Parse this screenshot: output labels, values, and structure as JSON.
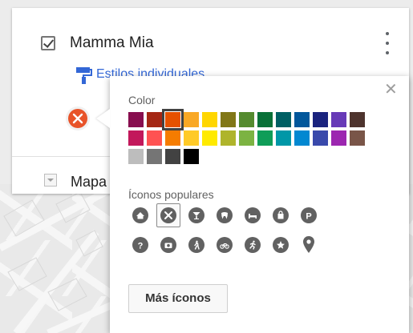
{
  "layer": {
    "title": "Mamma Mia",
    "checked": true,
    "style_label": "Estilos individuales",
    "category_icon": "restaurant-icon",
    "category_color": "#e8542a"
  },
  "base_map": {
    "label": "Mapa base"
  },
  "popup": {
    "color_label": "Color",
    "icons_label": "Íconos populares",
    "more_icons_label": "Más íconos",
    "close_icon": "close-icon",
    "selected_color": "#e65100",
    "colors": [
      [
        "#880e4f",
        "#a52714",
        "#e65100",
        "#f9a825",
        "#ffd600",
        "#817717",
        "#558b2f",
        "#097138",
        "#006064",
        "#01579b",
        "#1a237e",
        "#673ab7",
        "#4e342e"
      ],
      [
        "#c2185b",
        "#ff5252",
        "#f57c00",
        "#ffca28",
        "#ffea00",
        "#afb42b",
        "#7cb342",
        "#0f9d58",
        "#0097a7",
        "#0288d1",
        "#3949ab",
        "#9c27b0",
        "#795548"
      ],
      [
        "#bdbdbd",
        "#757575",
        "#424242",
        "#000000"
      ]
    ],
    "icons": [
      [
        "home-icon",
        "restaurant-icon",
        "cocktail-icon",
        "tooth-icon",
        "hotel-bed-icon",
        "shopping-bag-icon",
        "parking-icon"
      ],
      [
        "help-icon",
        "camera-icon",
        "hiking-icon",
        "bicycle-icon",
        "running-icon",
        "star-icon",
        "map-pin-icon"
      ]
    ],
    "selected_icon": "restaurant-icon"
  }
}
